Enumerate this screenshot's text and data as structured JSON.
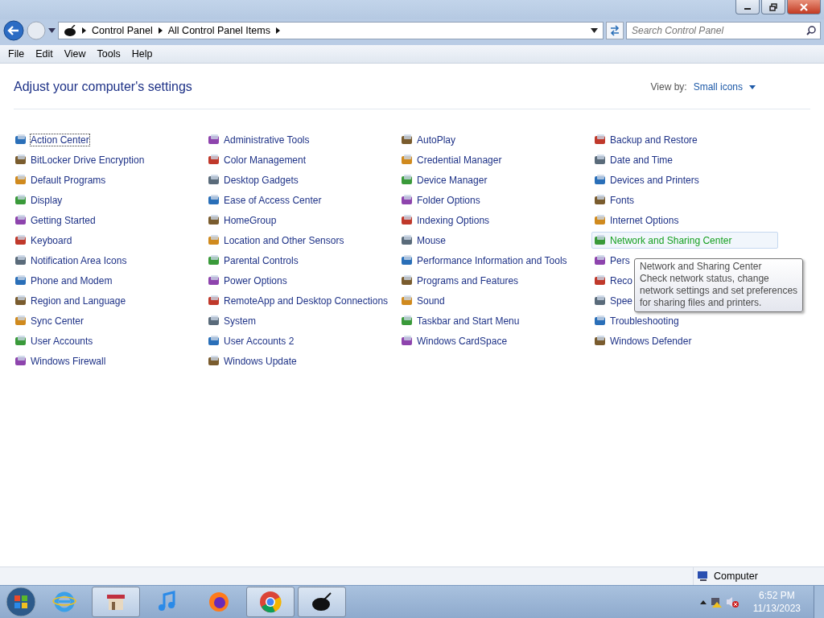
{
  "address_bar": {
    "crumbs": [
      "Control Panel",
      "All Control Panel Items"
    ]
  },
  "search": {
    "placeholder": "Search Control Panel"
  },
  "menu": [
    "File",
    "Edit",
    "View",
    "Tools",
    "Help"
  ],
  "heading": "Adjust your computer's settings",
  "view_by": {
    "label": "View by:",
    "value": "Small icons"
  },
  "columns": [
    [
      {
        "label": "Action Center",
        "focused": true,
        "hovered": false
      },
      {
        "label": "BitLocker Drive Encryption",
        "focused": false,
        "hovered": false
      },
      {
        "label": "Default Programs",
        "focused": false,
        "hovered": false
      },
      {
        "label": "Display",
        "focused": false,
        "hovered": false
      },
      {
        "label": "Getting Started",
        "focused": false,
        "hovered": false
      },
      {
        "label": "Keyboard",
        "focused": false,
        "hovered": false
      },
      {
        "label": "Notification Area Icons",
        "focused": false,
        "hovered": false
      },
      {
        "label": "Phone and Modem",
        "focused": false,
        "hovered": false
      },
      {
        "label": "Region and Language",
        "focused": false,
        "hovered": false
      },
      {
        "label": "Sync Center",
        "focused": false,
        "hovered": false
      },
      {
        "label": "User Accounts",
        "focused": false,
        "hovered": false
      },
      {
        "label": "Windows Firewall",
        "focused": false,
        "hovered": false
      }
    ],
    [
      {
        "label": "Administrative Tools",
        "focused": false,
        "hovered": false
      },
      {
        "label": "Color Management",
        "focused": false,
        "hovered": false
      },
      {
        "label": "Desktop Gadgets",
        "focused": false,
        "hovered": false
      },
      {
        "label": "Ease of Access Center",
        "focused": false,
        "hovered": false
      },
      {
        "label": "HomeGroup",
        "focused": false,
        "hovered": false
      },
      {
        "label": "Location and Other Sensors",
        "focused": false,
        "hovered": false
      },
      {
        "label": "Parental Controls",
        "focused": false,
        "hovered": false
      },
      {
        "label": "Power Options",
        "focused": false,
        "hovered": false
      },
      {
        "label": "RemoteApp and Desktop Connections",
        "focused": false,
        "hovered": false
      },
      {
        "label": "System",
        "focused": false,
        "hovered": false
      },
      {
        "label": "User Accounts 2",
        "focused": false,
        "hovered": false
      },
      {
        "label": "Windows Update",
        "focused": false,
        "hovered": false
      }
    ],
    [
      {
        "label": "AutoPlay",
        "focused": false,
        "hovered": false
      },
      {
        "label": "Credential Manager",
        "focused": false,
        "hovered": false
      },
      {
        "label": "Device Manager",
        "focused": false,
        "hovered": false
      },
      {
        "label": "Folder Options",
        "focused": false,
        "hovered": false
      },
      {
        "label": "Indexing Options",
        "focused": false,
        "hovered": false
      },
      {
        "label": "Mouse",
        "focused": false,
        "hovered": false
      },
      {
        "label": "Performance Information and Tools",
        "focused": false,
        "hovered": false
      },
      {
        "label": "Programs and Features",
        "focused": false,
        "hovered": false
      },
      {
        "label": "Sound",
        "focused": false,
        "hovered": false
      },
      {
        "label": "Taskbar and Start Menu",
        "focused": false,
        "hovered": false
      },
      {
        "label": "Windows CardSpace",
        "focused": false,
        "hovered": false
      }
    ],
    [
      {
        "label": "Backup and Restore",
        "focused": false,
        "hovered": false
      },
      {
        "label": "Date and Time",
        "focused": false,
        "hovered": false
      },
      {
        "label": "Devices and Printers",
        "focused": false,
        "hovered": false
      },
      {
        "label": "Fonts",
        "focused": false,
        "hovered": false
      },
      {
        "label": "Internet Options",
        "focused": false,
        "hovered": false
      },
      {
        "label": "Network and Sharing Center",
        "focused": false,
        "hovered": true
      },
      {
        "label": "Pers",
        "focused": false,
        "hovered": false
      },
      {
        "label": "Reco",
        "focused": false,
        "hovered": false
      },
      {
        "label": "Spee",
        "focused": false,
        "hovered": false
      },
      {
        "label": "Troubleshooting",
        "focused": false,
        "hovered": false
      },
      {
        "label": "Windows Defender",
        "focused": false,
        "hovered": false
      }
    ]
  ],
  "tooltip": {
    "title": "Network and Sharing Center",
    "lines": [
      "Check network status, change",
      "network settings and set preferences",
      "for sharing files and printers."
    ]
  },
  "status_bar": {
    "text": "Computer"
  },
  "taskbar": {
    "apps": [
      {
        "kind": "ie",
        "selected": false
      },
      {
        "kind": "store",
        "selected": true
      },
      {
        "kind": "music",
        "selected": false
      },
      {
        "kind": "firefox",
        "selected": false
      },
      {
        "kind": "chrome",
        "selected": true
      },
      {
        "kind": "pot",
        "selected": true
      }
    ],
    "time": "6:52 PM",
    "date": "11/13/2023"
  }
}
